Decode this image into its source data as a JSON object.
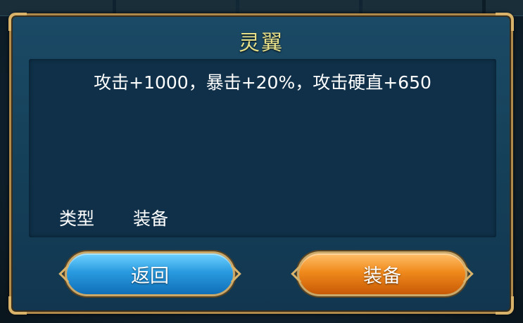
{
  "dialog": {
    "title": "灵翼",
    "description": "攻击+1000，暴击+20%，攻击硬直+650",
    "type_label": "类型",
    "type_value": "装备"
  },
  "buttons": {
    "back_label": "返回",
    "equip_label": "装备"
  },
  "colors": {
    "title": "#e6e08a",
    "frame": "#b08a4a",
    "back_button": "#2a9be0",
    "equip_button": "#f08a1c"
  }
}
